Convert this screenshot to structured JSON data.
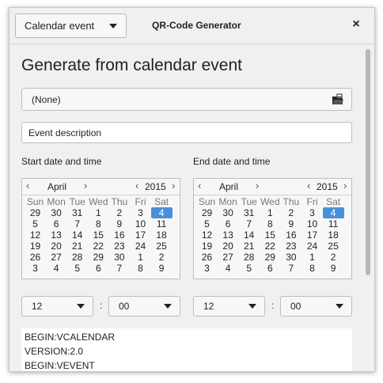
{
  "window": {
    "title": "QR-Code Generator",
    "type_selector": "Calendar event",
    "close_label": "×"
  },
  "main": {
    "heading": "Generate from calendar event",
    "calendar_selector": "(None)",
    "description": "Event description",
    "start_label": "Start date and time",
    "end_label": "End date and time"
  },
  "calendar": {
    "month": "April",
    "year": "2015",
    "weekdays": [
      "Sun",
      "Mon",
      "Tue",
      "Wed",
      "Thu",
      "Fri",
      "Sat"
    ],
    "weeks": [
      [
        "29",
        "30",
        "31",
        "1",
        "2",
        "3",
        "4"
      ],
      [
        "5",
        "6",
        "7",
        "8",
        "9",
        "10",
        "11"
      ],
      [
        "12",
        "13",
        "14",
        "15",
        "16",
        "17",
        "18"
      ],
      [
        "19",
        "20",
        "21",
        "22",
        "23",
        "24",
        "25"
      ],
      [
        "26",
        "27",
        "28",
        "29",
        "30",
        "1",
        "2"
      ],
      [
        "3",
        "4",
        "5",
        "6",
        "7",
        "8",
        "9"
      ]
    ],
    "selected_day": "4"
  },
  "start_time": {
    "hour": "12",
    "minute": "00"
  },
  "end_time": {
    "hour": "12",
    "minute": "00"
  },
  "colon": ":",
  "output_lines": [
    "BEGIN:VCALENDAR",
    "VERSION:2.0",
    "BEGIN:VEVENT"
  ],
  "colors": {
    "selection": "#4a90d9",
    "background": "#f0f0f0"
  }
}
